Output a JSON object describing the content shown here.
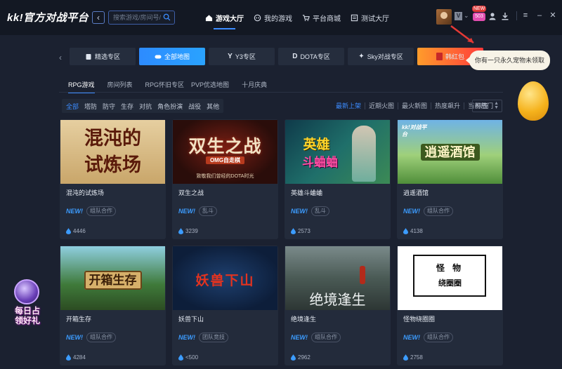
{
  "app": {
    "logo": "kk!官方对战平台",
    "search_placeholder": "搜索游戏/房间号/作者",
    "nav": [
      {
        "label": "游戏大厅",
        "icon": "home-icon",
        "active": true
      },
      {
        "label": "我的游戏",
        "icon": "gamepad-icon",
        "active": false
      },
      {
        "label": "平台商城",
        "icon": "cart-icon",
        "active": false
      },
      {
        "label": "测试大厅",
        "icon": "test-icon",
        "active": false
      }
    ],
    "vip_label": "V",
    "new_badge": "NEW",
    "gift_badge": "503"
  },
  "zones": [
    {
      "label": "精选专区",
      "icon": "card-icon",
      "active": false
    },
    {
      "label": "全部地图",
      "icon": "gamepad-icon",
      "active": true
    },
    {
      "label": "Y3专区",
      "icon": "y3-icon",
      "active": false
    },
    {
      "label": "DOTA专区",
      "icon": "dota-icon",
      "active": false
    },
    {
      "label": "Sky对战专区",
      "icon": "sky-icon",
      "active": false
    },
    {
      "label": "韩红包",
      "icon": "redpacket-icon",
      "active": false
    }
  ],
  "tooltip": "你有一只永久宠物未领取",
  "category_tabs": [
    {
      "label": "RPG游戏",
      "active": true
    },
    {
      "label": "房间列表",
      "active": false
    },
    {
      "label": "RPG怀旧专区",
      "active": false
    },
    {
      "label": "PVP优选地图",
      "active": false
    },
    {
      "label": "十月庆典",
      "active": false
    }
  ],
  "filters": [
    {
      "label": "全部",
      "active": true
    },
    {
      "label": "塔防",
      "active": false
    },
    {
      "label": "防守",
      "active": false
    },
    {
      "label": "生存",
      "active": false
    },
    {
      "label": "对抗",
      "active": false
    },
    {
      "label": "角色扮演",
      "active": false
    },
    {
      "label": "战役",
      "active": false
    },
    {
      "label": "其他",
      "active": false
    }
  ],
  "sorts": [
    {
      "label": "最新上架",
      "active": true
    },
    {
      "label": "近期火图",
      "active": false
    },
    {
      "label": "最火新图",
      "active": false
    },
    {
      "label": "热度飙升",
      "active": false
    },
    {
      "label": "当前热门",
      "active": false
    }
  ],
  "tag_select": "标签",
  "games": [
    {
      "name": "混沌的试炼场",
      "thumb_text": "混沌的\n试炼场",
      "new": "NEW!",
      "tag": "组队合作",
      "count": "4446",
      "theme": "chaos"
    },
    {
      "name": "双生之战",
      "thumb_text": "双生之战",
      "thumb_sub": "OMG自走棋",
      "thumb_caption": "致敬我们曾经的DOTA时光",
      "new": "NEW!",
      "tag": "乱斗",
      "count": "3239",
      "theme": "twin"
    },
    {
      "name": "英雄斗蛐蛐",
      "thumb_text": "英雄",
      "thumb_text2": "斗蛐蛐",
      "new": "NEW!",
      "tag": "乱斗",
      "count": "2573",
      "theme": "hero"
    },
    {
      "name": "逍遥酒馆",
      "thumb_text": "逍遥酒馆",
      "thumb_logo": "kk!对战平台",
      "new": "NEW!",
      "tag": "组队合作",
      "count": "4138",
      "theme": "tavern"
    },
    {
      "name": "开箱生存",
      "thumb_text": "开箱生存",
      "new": "NEW!",
      "tag": "组队合作",
      "count": "4284",
      "theme": "box"
    },
    {
      "name": "妖兽下山",
      "thumb_text": "妖兽下山",
      "new": "NEW!",
      "tag": "团队竞技",
      "count": "<500",
      "theme": "beast"
    },
    {
      "name": "绝境逢生",
      "thumb_text": "绝境逢生",
      "new": "NEW!",
      "tag": "组队合作",
      "count": "2962",
      "theme": "desperate"
    },
    {
      "name": "怪物绕圈圈",
      "thumb_text": "怪 物",
      "thumb_text2": "绕圈圈",
      "new": "NEW!",
      "tag": "组队合作",
      "count": "2758",
      "theme": "monster"
    }
  ],
  "promo_text": "每日占\n领好礼",
  "colors": {
    "accent": "#3c8cff",
    "bg": "#1b2130",
    "card": "#232b3b"
  }
}
